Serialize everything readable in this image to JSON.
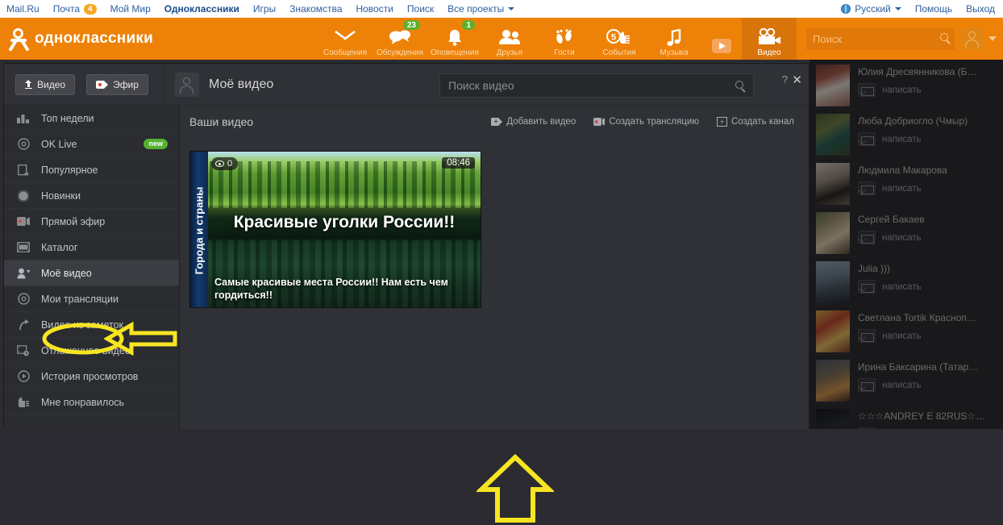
{
  "mailru": {
    "left_items": [
      {
        "label": "Mail.Ru",
        "bold": false,
        "badge": null
      },
      {
        "label": "Почта",
        "bold": false,
        "badge": "4"
      },
      {
        "label": "Мой Мир",
        "bold": false,
        "badge": null
      },
      {
        "label": "Одноклассники",
        "bold": true,
        "badge": null
      },
      {
        "label": "Игры",
        "bold": false,
        "badge": null
      },
      {
        "label": "Знакомства",
        "bold": false,
        "badge": null
      },
      {
        "label": "Новости",
        "bold": false,
        "badge": null
      },
      {
        "label": "Поиск",
        "bold": false,
        "badge": null
      },
      {
        "label": "Все проекты",
        "bold": false,
        "badge": null,
        "caret": true
      }
    ],
    "right_items": [
      {
        "label": "Русский",
        "icon": "globe-icon",
        "caret": true
      },
      {
        "label": "Помощь",
        "icon": null,
        "caret": false
      },
      {
        "label": "Выход",
        "icon": null,
        "caret": false
      }
    ]
  },
  "ok_header": {
    "brand": "одноклассники",
    "accent_color": "#ee8208",
    "nav": [
      {
        "label": "Сообщения",
        "icon": "envelope-icon",
        "badge": null,
        "active": false
      },
      {
        "label": "Обсуждения",
        "icon": "chat-bubbles-icon",
        "badge": "23",
        "active": false
      },
      {
        "label": "Оповещения",
        "icon": "bell-icon",
        "badge": "1",
        "active": false
      },
      {
        "label": "Друзья",
        "icon": "friends-icon",
        "badge": null,
        "active": false
      },
      {
        "label": "Гости",
        "icon": "footprints-icon",
        "badge": null,
        "active": false
      },
      {
        "label": "События",
        "icon": "events-hand-icon",
        "badge": null,
        "badge_inline": "5",
        "active": false
      },
      {
        "label": "Музыка",
        "icon": "music-note-icon",
        "badge": null,
        "active": false
      },
      {
        "label": "",
        "icon": "play-button-icon",
        "badge": null,
        "active": false
      },
      {
        "label": "Видео",
        "icon": "video-camera-icon",
        "badge": null,
        "active": true
      }
    ],
    "search_placeholder": "Поиск"
  },
  "video_app": {
    "upload_button": "Видео",
    "stream_button": "Эфир",
    "user_title": "Моё видео",
    "search_placeholder": "Поиск видео",
    "help_label": "?",
    "close_label": "✕",
    "sidebar": [
      {
        "label": "Топ недели",
        "icon": "chart-bars-icon",
        "badge": null,
        "active": false
      },
      {
        "label": "OK Live",
        "icon": "live-circle-icon",
        "badge": "new",
        "active": false
      },
      {
        "label": "Популярное",
        "icon": "star-film-icon",
        "badge": null,
        "active": false
      },
      {
        "label": "Новинки",
        "icon": "sparkle-icon",
        "badge": null,
        "active": false
      },
      {
        "label": "Прямой эфир",
        "icon": "record-camera-icon",
        "badge": null,
        "active": false
      },
      {
        "label": "Каталог",
        "icon": "filmstrip-icon",
        "badge": null,
        "active": false
      },
      {
        "label": "Моё видео",
        "icon": "person-video-icon",
        "badge": null,
        "active": true
      },
      {
        "label": "Мои трансляции",
        "icon": "broadcast-icon",
        "badge": null,
        "active": false
      },
      {
        "label": "Видео из заметок",
        "icon": "share-arrow-icon",
        "badge": null,
        "active": false
      },
      {
        "label": "Отложенное видео",
        "icon": "clock-film-icon",
        "badge": null,
        "active": false
      },
      {
        "label": "История просмотров",
        "icon": "history-play-icon",
        "badge": null,
        "active": false
      },
      {
        "label": "Мне понравилось",
        "icon": "thumbs-up-icon",
        "badge": null,
        "active": false
      }
    ],
    "content": {
      "title": "Ваши видео",
      "actions": [
        {
          "label": "Добавить видео",
          "icon": "add-video-icon"
        },
        {
          "label": "Создать трансляцию",
          "icon": "record-camera-icon"
        },
        {
          "label": "Создать канал",
          "icon": "create-channel-icon"
        }
      ],
      "video_card": {
        "spine_text": "Города и страны",
        "views": "0",
        "duration": "08:46",
        "headline": "Красивые уголки России!!",
        "description": "Самые красивые места России!! Нам есть чем гордиться!!"
      }
    }
  },
  "friends": {
    "write_label": "написать",
    "items": [
      {
        "name": "Юлия Дресвянникова (Б…"
      },
      {
        "name": "Люба Добриогло (Чмыр)"
      },
      {
        "name": "Людмила Макарова"
      },
      {
        "name": "Сергей Бакаев"
      },
      {
        "name": "Julia )))"
      },
      {
        "name": "Светлана Tortik Красноп…"
      },
      {
        "name": "Ирина Баксарина (Татар…"
      },
      {
        "name": "☆☆☆ANDREY E 82RUS☆…"
      }
    ]
  },
  "annotations": {
    "highlight_color": "#f7e521",
    "ellipse_target": "Моё видео",
    "arrow_side_points_to": "Моё видео",
    "arrow_up_points_to": "video-card"
  }
}
